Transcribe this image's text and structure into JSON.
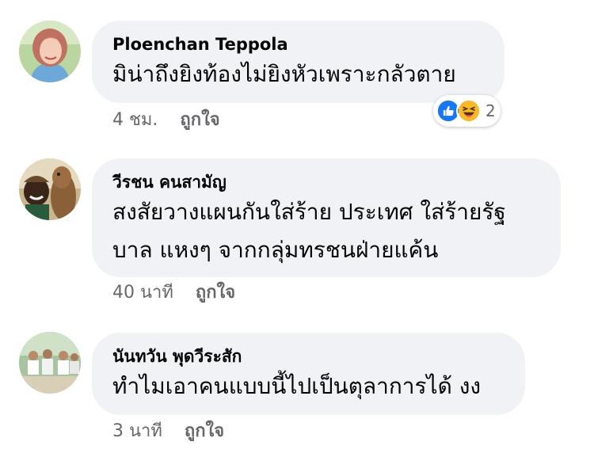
{
  "comments": [
    {
      "author": "Ploenchan Teppola",
      "text_lines": [
        "มิน่าถึงยิงท้องไม่ยิงหัวเพราะกลัวตาย"
      ],
      "time": "4 ชม.",
      "like_label": "ถูกใจ",
      "reactions": {
        "icons": [
          "like-icon",
          "haha-icon"
        ],
        "count": "2"
      }
    },
    {
      "author": "วีรชน คนสามัญ",
      "text_lines": [
        "สงสัยวางแผนกันใส่ร้าย ประเทศ ใส่ร้ายรัฐ",
        "บาล แหงๆ จากกลุ่มทรชนฝ่ายแค้น"
      ],
      "time": "40 นาที",
      "like_label": "ถูกใจ"
    },
    {
      "author": "นันทวัน พุดวีระสัก",
      "text_lines": [
        "ทำไมเอาคนแบบนี้ไปเป็นตุลาการได้ งง"
      ],
      "time": "3 นาที",
      "like_label": "ถูกใจ"
    }
  ],
  "colors": {
    "bubble": "#f0f2f5",
    "meta_text": "#65676b",
    "like_blue": "#1877f2",
    "haha_yellow": "#f7b928"
  }
}
